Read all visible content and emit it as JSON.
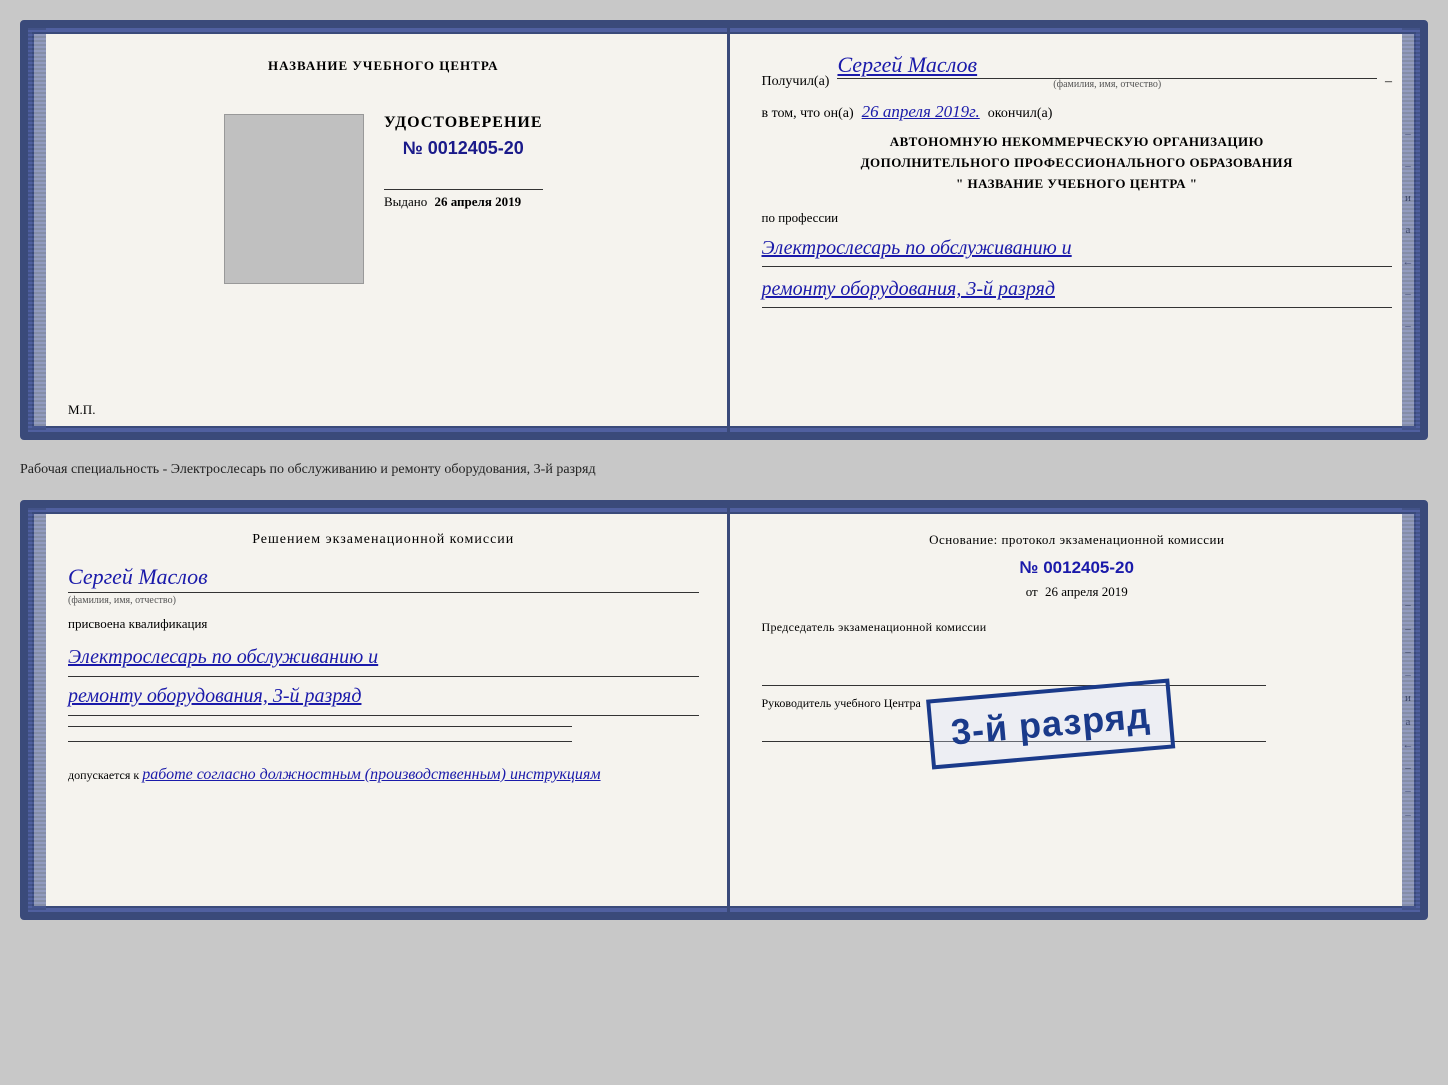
{
  "top_card": {
    "left": {
      "org_title": "НАЗВАНИЕ УЧЕБНОГО ЦЕНТРА",
      "udostoverenie_label": "УДОСТОВЕРЕНИЕ",
      "number": "№ 0012405-20",
      "vydano_label": "Выдано",
      "vydano_date": "26 апреля 2019",
      "mp_label": "М.П."
    },
    "right": {
      "poluchil_label": "Получил(а)",
      "person_name": "Сергей Маслов",
      "fio_label": "(фамилия, имя, отчество)",
      "dash": "–",
      "vtom_label": "в том, что он(а)",
      "vtom_date": "26 апреля 2019г.",
      "okonchil_label": "окончил(а)",
      "org_line1": "АВТОНОМНУЮ НЕКОММЕРЧЕСКУЮ ОРГАНИЗАЦИЮ",
      "org_line2": "ДОПОЛНИТЕЛЬНОГО ПРОФЕССИОНАЛЬНОГО ОБРАЗОВАНИЯ",
      "org_line3": "\"  НАЗВАНИЕ УЧЕБНОГО ЦЕНТРА  \"",
      "po_professii_label": "по профессии",
      "profession_line1": "Электрослесарь по обслуживанию и",
      "profession_line2": "ремонту оборудования, 3-й разряд"
    }
  },
  "info_strip": {
    "text": "Рабочая специальность - Электрослесарь по обслуживанию и ремонту оборудования, 3-й разряд"
  },
  "bottom_card": {
    "left": {
      "resolution_title": "Решением экзаменационной  комиссии",
      "person_name": "Сергей Маслов",
      "fio_label": "(фамилия, имя, отчество)",
      "prisvoena_label": "присвоена квалификация",
      "qualification_line1": "Электрослесарь по обслуживанию и",
      "qualification_line2": "ремонту оборудования, 3-й разряд",
      "dopuskaetsya_label": "допускается к",
      "dopuskaetsya_text": "работе согласно должностным (производственным) инструкциям"
    },
    "right": {
      "osnovanie_label": "Основание: протокол экзаменационной  комиссии",
      "protocol_number": "№  0012405-20",
      "ot_label": "от",
      "ot_date": "26 апреля 2019",
      "predsedatel_label": "Председатель экзаменационной комиссии",
      "rukovoditel_label": "Руководитель учебного Центра"
    },
    "stamp": {
      "text": "3-й разряд"
    }
  },
  "colors": {
    "border": "#3a4a7a",
    "handwriting": "#1a1aaa",
    "stamp": "#1a3a8a",
    "background": "#f5f3ee"
  }
}
